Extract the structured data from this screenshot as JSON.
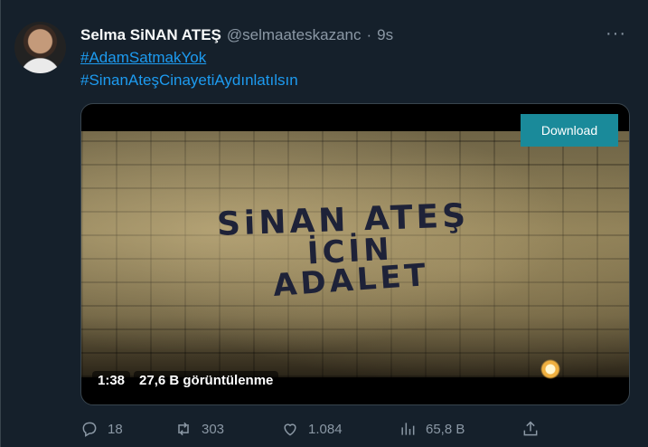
{
  "tweet": {
    "author_name": "Selma SiNAN ATEŞ",
    "handle": "@selmaateskazanc",
    "separator": "·",
    "time": "9s",
    "more_label": "···",
    "hashtags": [
      "#AdamSatmakYok",
      "#SinanAteşCinayetiAydınlatılsın"
    ]
  },
  "media": {
    "graffiti_lines": [
      "SiNAN ATEŞ",
      "İCİN",
      "ADALET"
    ],
    "download_label": "Download",
    "duration": "1:38",
    "views": "27,6 B görüntülenme"
  },
  "actions": {
    "reply_count": "18",
    "retweet_count": "303",
    "like_count": "1.084",
    "views_count": "65,8 B",
    "icons": [
      "reply-icon",
      "retweet-icon",
      "like-icon",
      "views-icon",
      "share-icon"
    ]
  },
  "colors": {
    "background": "#15202b",
    "accent": "#1d9bf0",
    "muted": "#8b98a5",
    "download_button": "#1a8a9a"
  }
}
